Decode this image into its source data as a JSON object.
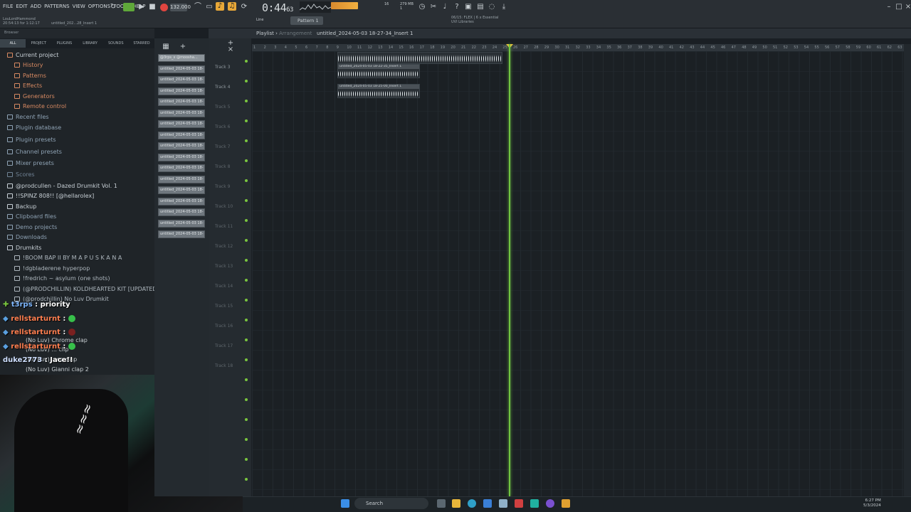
{
  "menu": [
    "FILE",
    "EDIT",
    "ADD",
    "PATTERNS",
    "VIEW",
    "OPTIONS",
    "TOOLS",
    "HELP"
  ],
  "tempo": "132.000",
  "clock": "0:44",
  "clock_frac": "63",
  "cpu": "16",
  "memory": "279 MB",
  "memory2": "1",
  "user": "LouLordHammond",
  "user_time": "20:54:13 for 1:12:17",
  "song_name": "untitled_202...28_Insert 1",
  "snap": "Line",
  "pattern": "Pattern 1",
  "loop_info": "06/15: FLEX | 6 x Essential",
  "loop_info2": "UVI Libraries",
  "browser": {
    "header": "Browser",
    "tabs": [
      "ALL",
      "PROJECT",
      "PLUGINS",
      "LIBRARY",
      "SOUNDS",
      "STARRED"
    ],
    "items": [
      {
        "label": "Current project"
      },
      {
        "label": "History"
      },
      {
        "label": "Patterns"
      },
      {
        "label": "Effects"
      },
      {
        "label": "Generators"
      },
      {
        "label": "Remote control"
      },
      {
        "label": "Recent files"
      },
      {
        "label": "Plugin database"
      },
      {
        "label": "Plugin presets"
      },
      {
        "label": "Channel presets"
      },
      {
        "label": "Mixer presets"
      },
      {
        "label": "Scores"
      },
      {
        "label": "@prodcullen - Dazed Drumkit Vol. 1"
      },
      {
        "label": "!!SPINZ 808!! [@hellarolex]"
      },
      {
        "label": "Backup"
      },
      {
        "label": "Clipboard files"
      },
      {
        "label": "Demo projects"
      },
      {
        "label": "Downloads"
      },
      {
        "label": "Drumkits"
      },
      {
        "label": "!BOOM BAP II BY M A P U S K A N A"
      },
      {
        "label": "!dgbladerene hyperpop"
      },
      {
        "label": "!fredrich ~ asylum (one shots)"
      },
      {
        "label": "(@PRODCHILLIN) KOLDHEARTED KIT [UPDATED]"
      },
      {
        "label": "(@prodchillin) No Luv Drumkit"
      }
    ]
  },
  "chat": [
    {
      "user": "t3rps",
      "msg": "priority"
    },
    {
      "user": "rellstarturnt",
      "msg": ""
    },
    {
      "user": "rellstarturnt",
      "msg": ""
    },
    {
      "user": "rellstarturnt",
      "msg": ""
    },
    {
      "user": "duke2773",
      "msg": "Jace!!"
    }
  ],
  "chat_subs": [
    "(No Luv) Chrome clap",
    "(No Luv) ... clip",
    "(No Luv) ...se clap",
    "(No Luv) Gianni clap 2"
  ],
  "patterns": {
    "first": "@3rps_x @moosha...",
    "items": [
      "untitled_2024-05-03 18-",
      "untitled_2024-05-03 18-",
      "untitled_2024-05-03 18-",
      "untitled_2024-05-03 18-",
      "untitled_2024-05-03 18-",
      "untitled_2024-05-03 18-",
      "untitled_2024-05-03 18-",
      "untitled_2024-05-03 18-",
      "untitled_2024-05-03 18-",
      "untitled_2024-05-03 18-",
      "untitled_2024-05-03 18-",
      "untitled_2024-05-03 18-",
      "untitled_2024-05-03 18-",
      "untitled_2024-05-03 18-",
      "untitled_2024-05-03 18-",
      "untitled_2024-05-03 18-",
      "untitled_2024-05-03 18-"
    ]
  },
  "playlist": {
    "title": "Playlist",
    "section": "Arrangement",
    "file": "untitled_2024-05-03 18-27-34_Insert 1",
    "tracks": [
      "Track 3",
      "Track 4",
      "Track 5",
      "Track 6",
      "Track 7",
      "Track 8",
      "Track 9",
      "Track 10",
      "Track 11",
      "Track 12",
      "Track 13",
      "Track 14",
      "Track 15",
      "Track 16",
      "Track 17",
      "Track 18"
    ],
    "clips": [
      "untitled_2024-05-03 18-22-35_Insert 1",
      "untitled_2024-05-03 18-25-00_Insert 1"
    ],
    "ruler": [
      "1",
      "2",
      "3",
      "4",
      "5",
      "6",
      "7",
      "8",
      "9",
      "10",
      "11",
      "12",
      "13",
      "14",
      "15",
      "16",
      "17",
      "18",
      "19",
      "20",
      "21",
      "22",
      "23",
      "24",
      "25",
      "26",
      "27",
      "28",
      "29",
      "30",
      "31",
      "32",
      "33",
      "34",
      "35",
      "36",
      "37",
      "38",
      "39",
      "40",
      "41",
      "42",
      "43",
      "44",
      "45",
      "46",
      "47",
      "48",
      "49",
      "50",
      "51",
      "52",
      "53",
      "54",
      "55",
      "56",
      "57",
      "58",
      "59",
      "60",
      "61",
      "62",
      "63"
    ]
  },
  "taskbar": {
    "search": "Search",
    "time": "6:27 PM",
    "date": "5/3/2024"
  }
}
